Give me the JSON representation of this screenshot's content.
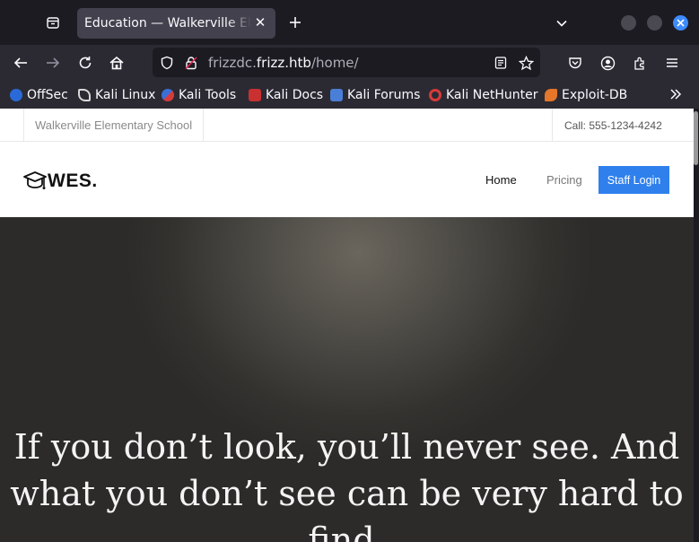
{
  "browser": {
    "tab_title": "Education — Walkerville Elementary School",
    "url_prefix": "frizzdc.",
    "url_host": "frizz.htb",
    "url_path": "/home/",
    "bookmarks": [
      {
        "label": "OffSec",
        "icon": "offsec-icon",
        "color": "#2a6ad8"
      },
      {
        "label": "Kali Linux",
        "icon": "kali-dragon-icon",
        "color": "#e0e0e0"
      },
      {
        "label": "Kali Tools",
        "icon": "kali-tools-icon",
        "color": "#d63b3b"
      },
      {
        "label": "Kali Docs",
        "icon": "kali-docs-icon",
        "color": "#c93030"
      },
      {
        "label": "Kali Forums",
        "icon": "kali-forums-icon",
        "color": "#4a7fd8"
      },
      {
        "label": "Kali NetHunter",
        "icon": "nethunter-icon",
        "color": "#d63b3b"
      },
      {
        "label": "Exploit-DB",
        "icon": "exploitdb-icon",
        "color": "#e5762a"
      }
    ]
  },
  "site": {
    "school_name": "Walkerville Elementary School",
    "call": "Call: 555-1234-4242",
    "logo_text": "WES.",
    "nav": {
      "home": "Home",
      "pricing": "Pricing",
      "staff_login": "Staff Login"
    },
    "hero_quote": "If you don’t look, you’ll never see. And what you don’t see can be very hard to find."
  },
  "colors": {
    "accent": "#2f80ed",
    "browser_bg": "#1c1b22",
    "toolbar_bg": "#2b2a33"
  }
}
